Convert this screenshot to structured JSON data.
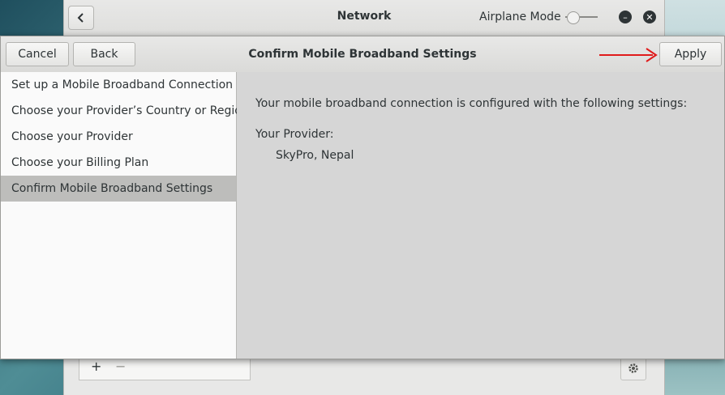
{
  "background_window": {
    "title": "Network",
    "airplane_mode_label": "Airplane Mode",
    "add_label": "+",
    "remove_label": "−"
  },
  "dialog": {
    "title": "Confirm Mobile Broadband Settings",
    "cancel_label": "Cancel",
    "back_label": "Back",
    "apply_label": "Apply",
    "annotation_arrow_color": "#e01b1b",
    "sidebar": {
      "items": [
        {
          "label": "Set up a Mobile Broadband Connection"
        },
        {
          "label": "Choose your Provider’s Country or Region"
        },
        {
          "label": "Choose your Provider"
        },
        {
          "label": "Choose your Billing Plan"
        },
        {
          "label": "Confirm Mobile Broadband Settings",
          "selected": true
        }
      ]
    },
    "content": {
      "intro": "Your mobile broadband connection is configured with the following settings:",
      "provider_label": "Your Provider:",
      "provider_value": "SkyPro, Nepal"
    }
  }
}
